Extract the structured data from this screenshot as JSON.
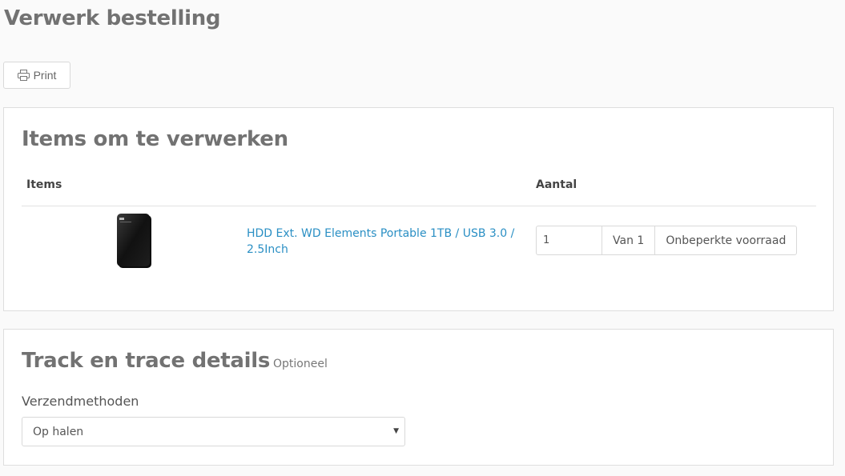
{
  "page": {
    "title": "Verwerk bestelling"
  },
  "toolbar": {
    "print_label": "Print",
    "print_icon": "printer-icon"
  },
  "items_section": {
    "title": "Items om te verwerken",
    "columns": {
      "items": "Items",
      "quantity": "Aantal"
    },
    "rows": [
      {
        "product_name": "HDD Ext. WD Elements Portable 1TB / USB 3.0 / 2.5Inch",
        "quantity_value": "1",
        "of_label": "Van 1",
        "stock_label": "Onbeperkte voorraad",
        "image": "external-hard-drive-image"
      }
    ]
  },
  "tracking_section": {
    "title": "Track en trace details",
    "optional_label": "Optioneel",
    "shipping_label": "Verzendmethoden",
    "shipping_selected": "Op halen"
  },
  "colors": {
    "link": "#2a8fc4",
    "heading": "#727272",
    "border": "#dedede",
    "background": "#fafafa"
  }
}
